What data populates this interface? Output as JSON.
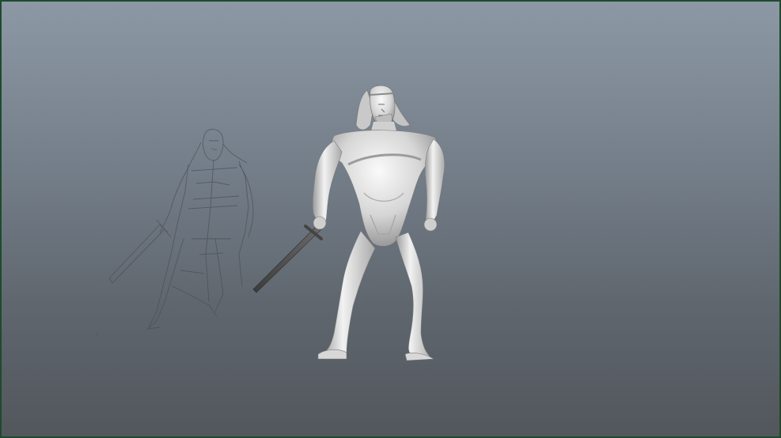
{
  "viewport": {
    "background_top": "#8c98a4",
    "background_bottom": "#52575c",
    "border_color": "#1f4a2e"
  },
  "objects": [
    {
      "name": "concept-sketch",
      "kind": "reference-image-plane",
      "description_icon": "pencil-sketch-warrior-with-sword"
    },
    {
      "name": "character-model",
      "kind": "3d-mesh",
      "description_icon": "shaded-warrior-with-sword"
    }
  ]
}
